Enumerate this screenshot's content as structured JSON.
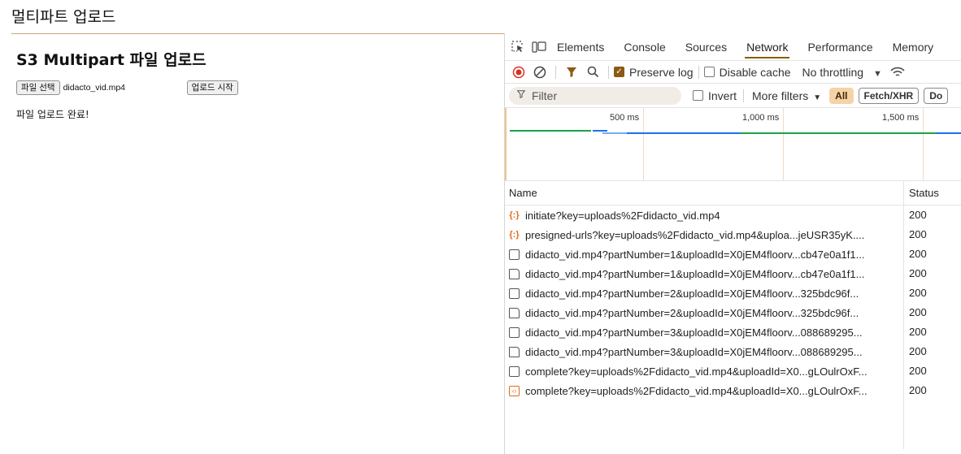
{
  "window": {
    "title": "멀티파트 업로드"
  },
  "page": {
    "heading": "S3 Multipart 파일 업로드",
    "choose_file_label": "파일 선택",
    "file_name": "didacto_vid.mp4",
    "start_upload_label": "업로드 시작",
    "status": "파일 업로드 완료!"
  },
  "devtools": {
    "tabs": [
      {
        "label": "Elements"
      },
      {
        "label": "Console"
      },
      {
        "label": "Sources"
      },
      {
        "label": "Network",
        "active": true
      },
      {
        "label": "Performance"
      },
      {
        "label": "Memory"
      }
    ],
    "toolbar": {
      "preserve_log": "Preserve log",
      "disable_cache": "Disable cache",
      "throttling": "No throttling"
    },
    "filter": {
      "placeholder": "Filter",
      "invert": "Invert",
      "more_filters": "More filters",
      "types": [
        "All",
        "Fetch/XHR",
        "Do"
      ]
    },
    "overview": {
      "ticks": [
        "500 ms",
        "1,000 ms",
        "1,500 ms"
      ]
    },
    "columns": {
      "name": "Name",
      "status": "Status"
    },
    "requests": [
      {
        "icon": "xhr",
        "name": "initiate?key=uploads%2Fdidacto_vid.mp4",
        "status": "200"
      },
      {
        "icon": "xhr",
        "name": "presigned-urls?key=uploads%2Fdidacto_vid.mp4&uploa...jeUSR35yK....",
        "status": "200"
      },
      {
        "icon": "other",
        "name": "didacto_vid.mp4?partNumber=1&uploadId=X0jEM4floorv...cb47e0a1f1...",
        "status": "200"
      },
      {
        "icon": "doc",
        "name": "didacto_vid.mp4?partNumber=1&uploadId=X0jEM4floorv...cb47e0a1f1...",
        "status": "200"
      },
      {
        "icon": "other",
        "name": "didacto_vid.mp4?partNumber=2&uploadId=X0jEM4floorv...325bdc96f...",
        "status": "200"
      },
      {
        "icon": "doc",
        "name": "didacto_vid.mp4?partNumber=2&uploadId=X0jEM4floorv...325bdc96f...",
        "status": "200"
      },
      {
        "icon": "other",
        "name": "didacto_vid.mp4?partNumber=3&uploadId=X0jEM4floorv...088689295...",
        "status": "200"
      },
      {
        "icon": "doc",
        "name": "didacto_vid.mp4?partNumber=3&uploadId=X0jEM4floorv...088689295...",
        "status": "200"
      },
      {
        "icon": "other",
        "name": "complete?key=uploads%2Fdidacto_vid.mp4&uploadId=X0...gLOulrOxF...",
        "status": "200"
      },
      {
        "icon": "fetch",
        "name": "complete?key=uploads%2Fdidacto_vid.mp4&uploadId=X0...gLOulrOxF...",
        "status": "200"
      }
    ],
    "colors": {
      "accent": "#8a5a16",
      "xhr_icon": "#e06b1d",
      "waterfall_green": "#1aa34a",
      "waterfall_blue": "#1a73e8"
    }
  }
}
